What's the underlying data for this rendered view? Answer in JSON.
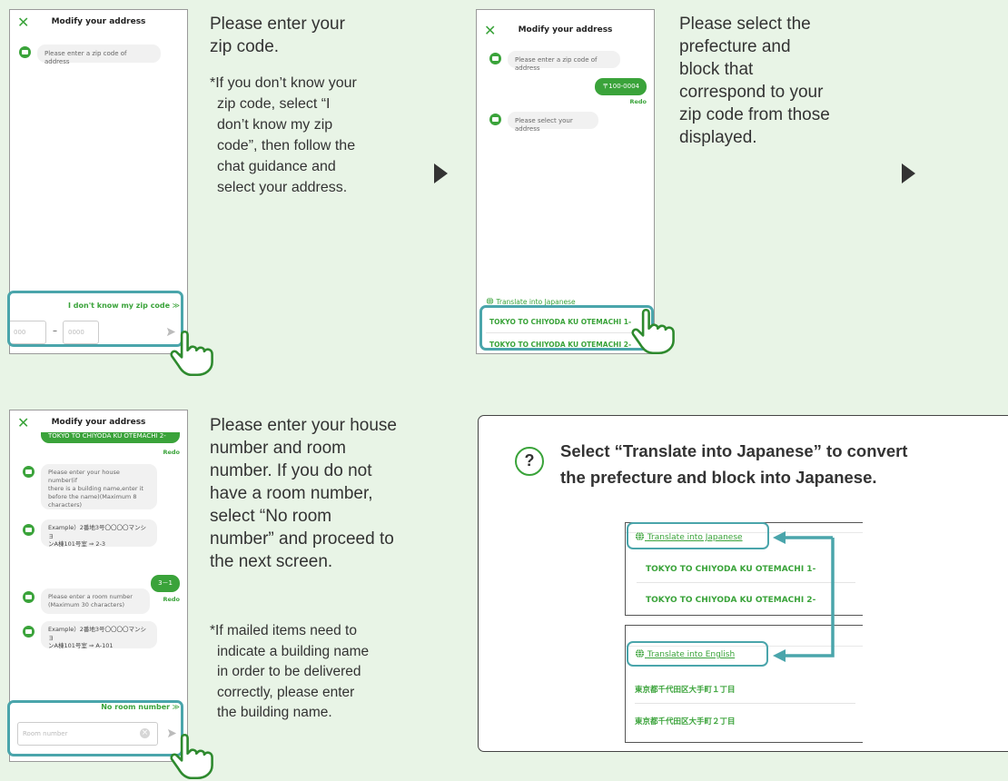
{
  "colors": {
    "background": "#e8f4e6",
    "accent_green": "#3aa33a",
    "highlight_teal": "#4aa5ab"
  },
  "phone1": {
    "title": "Modify your address",
    "bubble": "Please enter a zip code of address",
    "dont_know_link": "I don't know my zip code",
    "dont_know_arrow": "≫",
    "zip_placeholder_1": "000",
    "zip_dash": "–",
    "zip_placeholder_2": "0000"
  },
  "step1": {
    "description_lines": [
      "Please enter your",
      "zip code."
    ],
    "note_lines": [
      "*If you don’t know your",
      "zip code, select “I",
      "don’t know my zip",
      "code”, then follow the",
      "chat guidance and",
      "select your address."
    ]
  },
  "phone2": {
    "title": "Modify your address",
    "bubble1": "Please enter a zip code of address",
    "user_zip": "〒100-0004",
    "redo": "Redo",
    "bubble2": "Please select your address",
    "translate_link": "Translate into Japanese",
    "option1": "TOKYO TO CHIYODA KU OTEMACHI 1-",
    "option2": "TOKYO TO CHIYODA KU OTEMACHI 2-"
  },
  "step2": {
    "description_lines": [
      "Please select the",
      "prefecture and",
      "block that",
      "correspond to your",
      "zip code from those",
      "displayed."
    ]
  },
  "phone3": {
    "title": "Modify your address",
    "top_partial": "TOKYO TO CHIYODA KU OTEMACHI 2-",
    "redo1": "Redo",
    "bubble1_lines": [
      "Please enter your house number(if",
      "there is a building name,enter it",
      "before the name)(Maximum 8",
      "characters)"
    ],
    "example1_lines": [
      "Example）2番地3号〇〇〇〇マンショ",
      "ンA棟101号室 ⇒ 2-3"
    ],
    "user_reply": "3－1",
    "redo2": "Redo",
    "bubble2_lines": [
      "Please enter a room number",
      "(Maximum 30 characters)"
    ],
    "example2_lines": [
      "Example）2番地3号〇〇〇〇マンショ",
      "ンA棟101号室 ⇒ A-101"
    ],
    "no_room_link": "No room number",
    "no_room_arrow": "≫",
    "room_placeholder": "Room number",
    "clear_glyph": "×"
  },
  "step3": {
    "description_lines": [
      "Please enter your house",
      "number and room",
      "number. If you do not",
      "have a room number,",
      "select “No room",
      "number” and proceed to",
      "the next screen."
    ],
    "note_lines": [
      "*If mailed items need to",
      "indicate a building name",
      "in order to be delivered",
      "correctly, please enter",
      "the building name."
    ]
  },
  "info_box": {
    "question_mark": "?",
    "heading_lines": [
      "Select “Translate into Japanese” to convert",
      "the prefecture and block into Japanese."
    ],
    "upper_link": "Translate into Japanese",
    "upper_row1": "TOKYO TO CHIYODA KU OTEMACHI 1-",
    "upper_row2": "TOKYO TO CHIYODA KU OTEMACHI 2-",
    "lower_link": "Translate into English",
    "lower_row1": "東京都千代田区大手町１丁目",
    "lower_row2": "東京都千代田区大手町２丁目"
  }
}
